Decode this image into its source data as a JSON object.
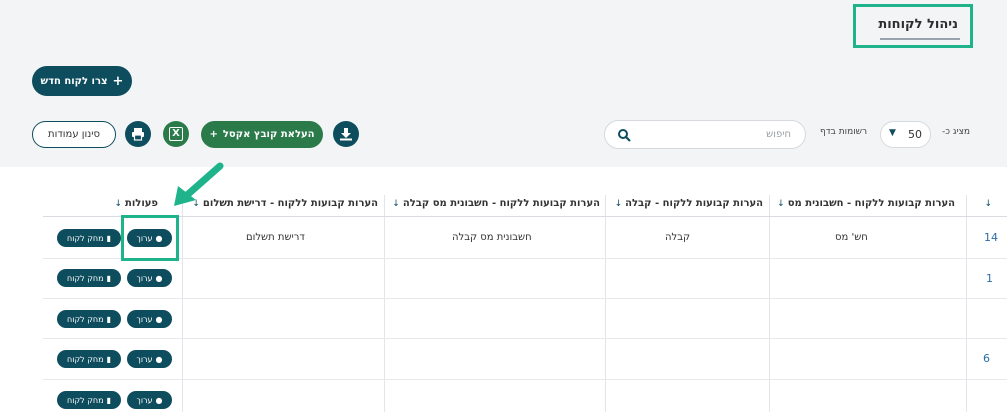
{
  "header": {
    "title": "ניהול לקוחות"
  },
  "toolbar": {
    "new_customer_label": "צרו לקוח חדש",
    "filter_columns_label": "סינון עמודות",
    "upload_excel_label": "העלאת קובץ אקסל",
    "excel_icon_text": "X",
    "search_placeholder": "חיפוש",
    "show_label": "מציג כ-",
    "per_page_value": "50",
    "per_page_label": "רשומות בדף"
  },
  "table": {
    "columns": [
      "",
      "הערות קבועות ללקוח - חשבונית מס",
      "הערות קבועות ללקוח - קבלה",
      "הערות קבועות ללקוח - חשבונית מס קבלה",
      "הערות קבועות ללקוח - דרישת תשלום",
      "פעולות"
    ],
    "rows": [
      {
        "id": "14",
        "invoice": "חש' מס",
        "receipt": "קבלה",
        "invoice_receipt": "חשבונית מס קבלה",
        "payment_request": "דרישת תשלום"
      },
      {
        "id": "1",
        "invoice": "",
        "receipt": "",
        "invoice_receipt": "",
        "payment_request": ""
      },
      {
        "id": "",
        "invoice": "",
        "receipt": "",
        "invoice_receipt": "",
        "payment_request": ""
      },
      {
        "id": "6",
        "invoice": "",
        "receipt": "",
        "invoice_receipt": "",
        "payment_request": ""
      },
      {
        "id": "",
        "invoice": "",
        "receipt": "",
        "invoice_receipt": "",
        "payment_request": ""
      }
    ],
    "actions": {
      "edit_label": "ערוך",
      "delete_label": "מחק לקוח"
    }
  },
  "colors": {
    "primary": "#0d4d5e",
    "excel_green": "#2a7a4a",
    "highlight": "#1fb38c"
  }
}
